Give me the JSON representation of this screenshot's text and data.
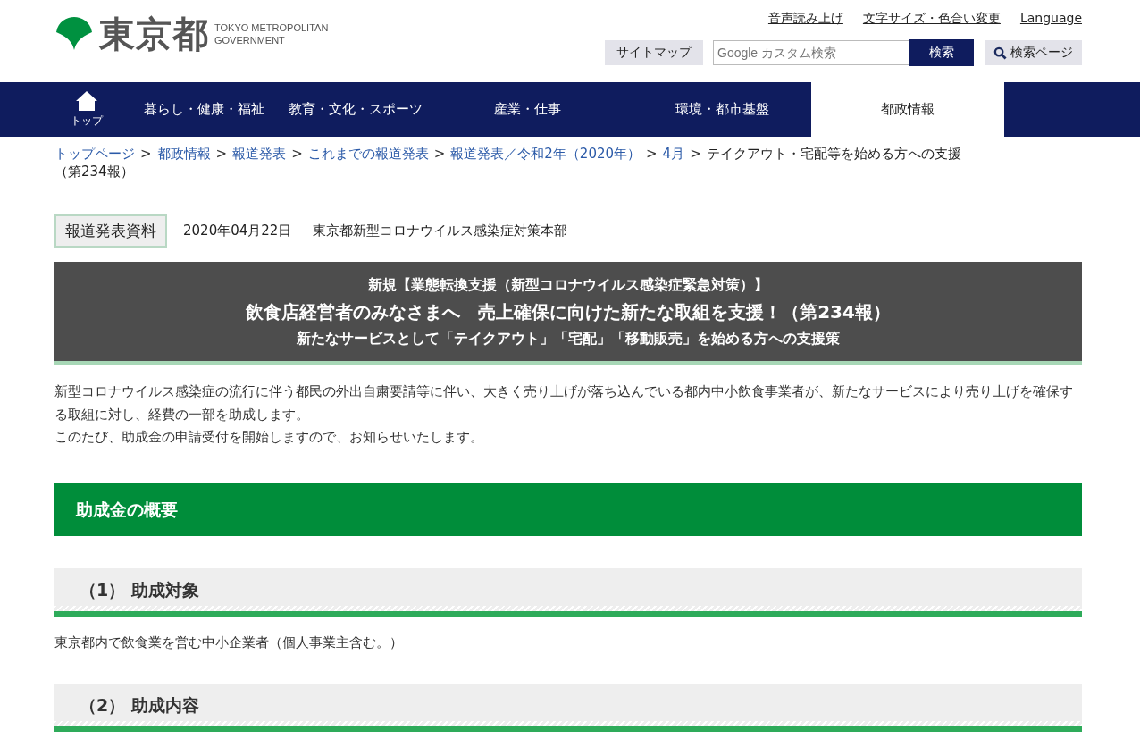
{
  "header": {
    "logo_text": "東京都",
    "logo_sub": "TOKYO METROPOLITAN GOVERNMENT",
    "util_links": [
      "音声読み上げ",
      "文字サイズ・色合い変更",
      "Language"
    ],
    "sitemap": "サイトマップ",
    "search": {
      "placeholder": "Google カスタム検索"
    },
    "search_button": "検索",
    "search_page": "検索ページ"
  },
  "nav": [
    {
      "kind": "home",
      "label": "トップ",
      "selected": false
    },
    {
      "kind": "text",
      "label": "暮らし・健康・福祉",
      "selected": false
    },
    {
      "kind": "text",
      "label": "教育・文化・スポーツ",
      "selected": false
    },
    {
      "kind": "text",
      "label": "産業・仕事",
      "selected": false
    },
    {
      "kind": "text",
      "label": "環境・都市基盤",
      "selected": false
    },
    {
      "kind": "text",
      "label": "都政情報",
      "selected": true
    }
  ],
  "breadcrumb": {
    "separator": ">",
    "links": [
      "トップページ",
      "都政情報",
      "報道発表",
      "これまでの報道発表",
      "報道発表／令和2年（2020年）",
      "4月"
    ],
    "current": [
      "テイクアウト・宅配等を始める方への支援",
      "（第234報）"
    ]
  },
  "meta": {
    "badge": "報道発表資料",
    "date": "2020年04月22日",
    "department": "東京都新型コロナウイルス感染症対策本部"
  },
  "title_box": {
    "lines": [
      "新規【業態転換支援（新型コロナウイルス感染症緊急対策）】",
      "飲食店経営者のみなさまへ　売上確保に向けた新たな取組を支援！（第234報）",
      "新たなサービスとして「テイクアウト」「宅配」「移動販売」を始める方への支援策"
    ]
  },
  "intro": [
    "新型コロナウイルス感染症の流行に伴う都民の外出自粛要請等に伴い、大きく売り上げが落ち込んでいる都内中小飲食事業者が、新たなサービスにより売り上げを確保する取組に対し、経費の一部を助成します。",
    "このたび、助成金の申請受付を開始しますので、お知らせいたします。"
  ],
  "section": {
    "heading": "助成金の概要",
    "subsections": [
      {
        "heading": "（1） 助成対象",
        "body": "東京都内で飲食業を営む中小企業者（個人事業主含む。）"
      },
      {
        "heading": "（2） 助成内容"
      }
    ]
  }
}
